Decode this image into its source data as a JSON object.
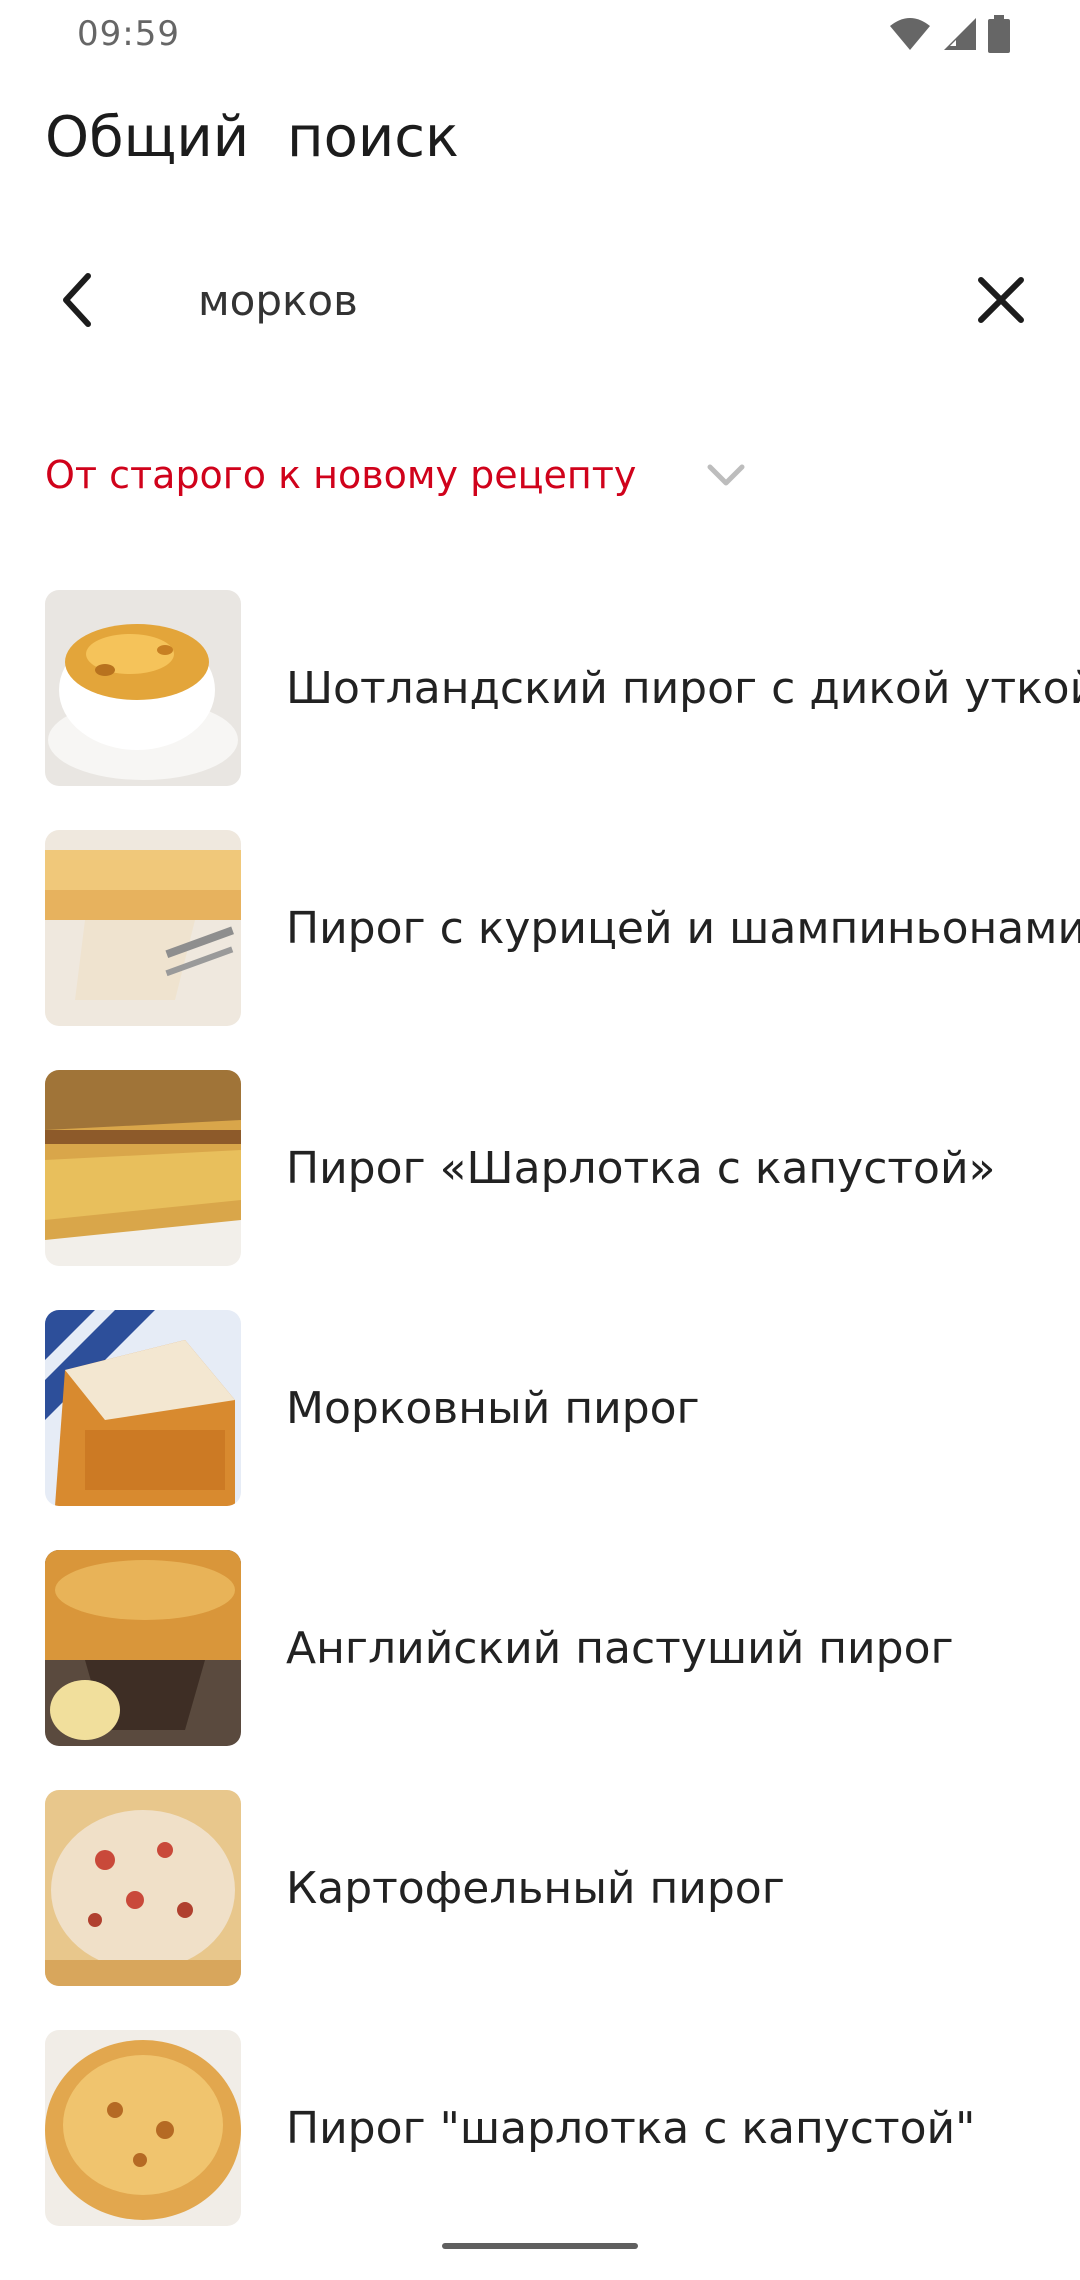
{
  "status_bar": {
    "time": "09:59",
    "icons": [
      "wifi-icon",
      "signal-icon",
      "battery-icon"
    ]
  },
  "header": {
    "title": "Общий поиск"
  },
  "search": {
    "value": "морков",
    "back_icon": "chevron-left-icon",
    "clear_icon": "close-icon"
  },
  "sort": {
    "label": "От старого к новому рецепту",
    "icon": "chevron-down-icon"
  },
  "results": [
    {
      "title": "Шотландский пирог с дикой уткой"
    },
    {
      "title": "Пирог с курицей и шампиньонами"
    },
    {
      "title": "Пирог «Шарлотка с капустой»"
    },
    {
      "title": "Морковный пирог"
    },
    {
      "title": "Английский пастуший пирог"
    },
    {
      "title": "Картофельный пирог"
    },
    {
      "title": "Пирог \"шарлотка с капустой\""
    }
  ],
  "colors": {
    "accent": "#d0021b",
    "text": "#222222",
    "status_text": "#666666"
  }
}
